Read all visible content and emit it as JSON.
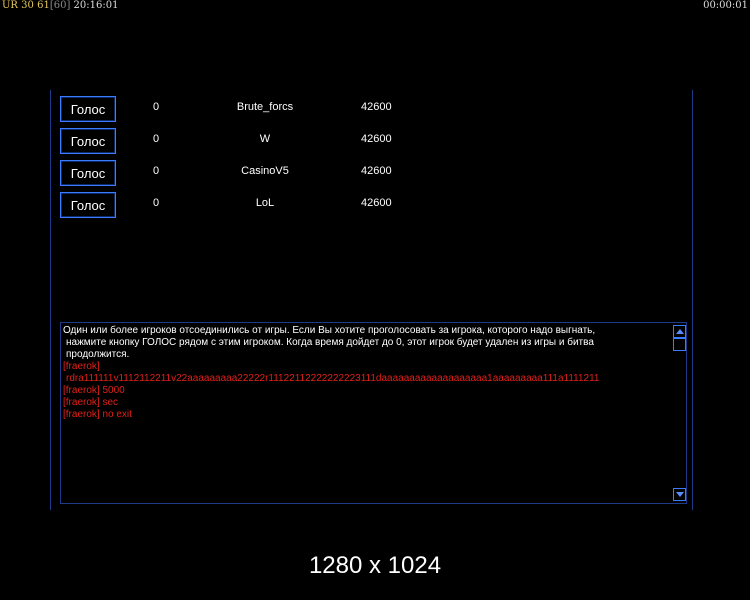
{
  "hud": {
    "ur_label": "UR",
    "ur_value": "30",
    "fps": "61",
    "fps_cap": "[60]",
    "clock": "20:16:01",
    "elapsed": "00:00:01"
  },
  "players": [
    {
      "button_label": "Голос",
      "votes": "0",
      "name": "Brute_forcs",
      "score": "42600"
    },
    {
      "button_label": "Голос",
      "votes": "0",
      "name": "W",
      "score": "42600"
    },
    {
      "button_label": "Голос",
      "votes": "0",
      "name": "CasinoV5",
      "score": "42600"
    },
    {
      "button_label": "Голос",
      "votes": "0",
      "name": "LoL",
      "score": "42600"
    }
  ],
  "chat": {
    "system_message": [
      "Один или более игроков отсоединились от игры. Если Вы хотите проголосовать за игрока, которого надо выгнать,",
      "нажмите кнопку ГОЛОС рядом с этим игроком. Когда время дойдет до 0, этот игрок будет удален из игры и битва",
      "продолжится."
    ],
    "messages": [
      "[fraerok]",
      "rdra111111v1112112211v22aaaaaaaaa22222r11122112222222223111daaaaaaaaaaaaaaaaaaa1aaaaaaaaa111a1111211",
      "[fraerok] 5000",
      "[fraerok] sec",
      "[fraerok] no exit"
    ]
  },
  "resolution_label": "1280 x 1024",
  "colors": {
    "background": "#000000",
    "accent_blue": "#3b7bff",
    "chat_red": "#e0201a",
    "hud_yellow": "#e8c85a"
  }
}
